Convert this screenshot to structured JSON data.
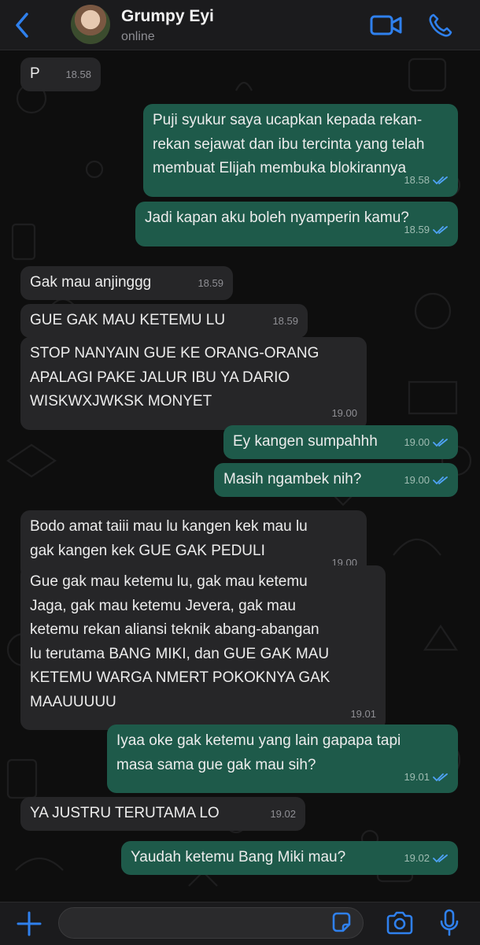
{
  "header": {
    "contact_name": "Grumpy Eyi",
    "status": "online",
    "back_icon": "chevron-left-icon",
    "video_icon": "video-camera-icon",
    "call_icon": "phone-icon",
    "accent": "#2f80ed"
  },
  "messages": [
    {
      "dir": "in",
      "text": "P",
      "time": "18.58"
    },
    {
      "dir": "out",
      "text": "Puji syukur saya ucapkan kepada rekan-\nrekan sejawat dan ibu tercinta yang telah\nmembuat Elijah membuka blokirannya",
      "time": "18.58"
    },
    {
      "dir": "out",
      "text": "Jadi kapan aku boleh nyamperin kamu?",
      "time": "18.59"
    },
    {
      "dir": "in",
      "text": "Gak mau anjinggg",
      "time": "18.59"
    },
    {
      "dir": "in",
      "text": "GUE GAK MAU KETEMU LU",
      "time": "18.59"
    },
    {
      "dir": "in",
      "text": "STOP NANYAIN GUE KE ORANG-ORANG\nAPALAGI PAKE JALUR IBU YA DARIO\nWISKWXJWKSK MONYET",
      "time": "19.00"
    },
    {
      "dir": "out",
      "text": "Ey kangen sumpahhh",
      "time": "19.00"
    },
    {
      "dir": "out",
      "text": "Masih ngambek nih?",
      "time": "19.00"
    },
    {
      "dir": "in",
      "text": "Bodo amat taiii mau lu kangen kek mau lu\ngak kangen kek GUE GAK PEDULI",
      "time": "19.00"
    },
    {
      "dir": "in",
      "text": "Gue gak mau ketemu lu, gak mau ketemu\nJaga, gak mau ketemu Jevera, gak mau\nketemu rekan aliansi teknik abang-abangan\nlu terutama BANG MIKI, dan GUE GAK MAU\nKETEMU WARGA NMERT POKOKNYA GAK\nMAAUUUUU",
      "time": "19.01"
    },
    {
      "dir": "out",
      "text": "Iyaa oke gak ketemu yang lain gapapa tapi\nmasa sama gue gak mau sih?",
      "time": "19.01"
    },
    {
      "dir": "in",
      "text": "YA JUSTRU TERUTAMA LO",
      "time": "19.02"
    },
    {
      "dir": "out",
      "text": "Yaudah ketemu Bang Miki mau?",
      "time": "19.02"
    }
  ],
  "composer": {
    "placeholder": "",
    "plus_icon": "plus-icon",
    "sticker_icon": "sticker-icon",
    "camera_icon": "camera-icon",
    "mic_icon": "microphone-icon"
  }
}
